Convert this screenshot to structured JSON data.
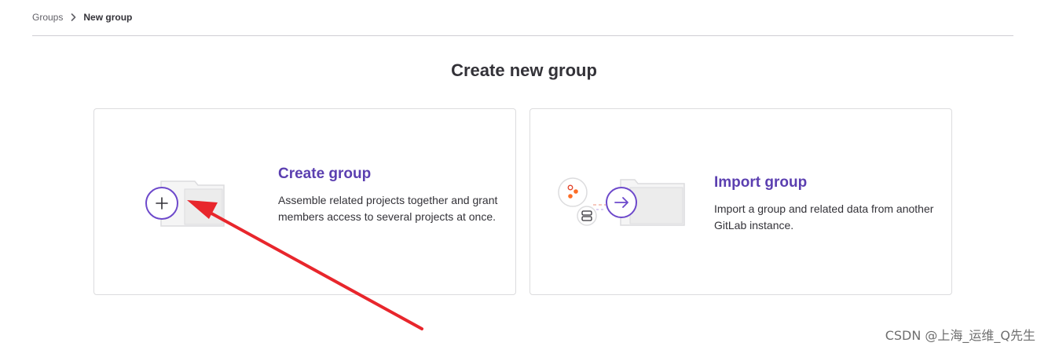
{
  "breadcrumb": {
    "items": [
      "Groups",
      "New group"
    ]
  },
  "page": {
    "title": "Create new group"
  },
  "cards": {
    "create": {
      "title": "Create group",
      "description": "Assemble related projects together and grant members access to several projects at once."
    },
    "import": {
      "title": "Import group",
      "description": "Import a group and related data from another GitLab instance."
    }
  },
  "watermark": {
    "text": "CSDN @上海_运维_Q先生"
  },
  "icons": {
    "create": [
      "folder-icon",
      "plus-icon"
    ],
    "import": [
      "folder-icon",
      "arrow-right-icon",
      "nodes-icon",
      "database-icon"
    ],
    "breadcrumb_separator": "chevron-right-icon"
  },
  "colors": {
    "accent": "#5b3fb0",
    "annotation": "#e8262c",
    "text": "#333238"
  }
}
